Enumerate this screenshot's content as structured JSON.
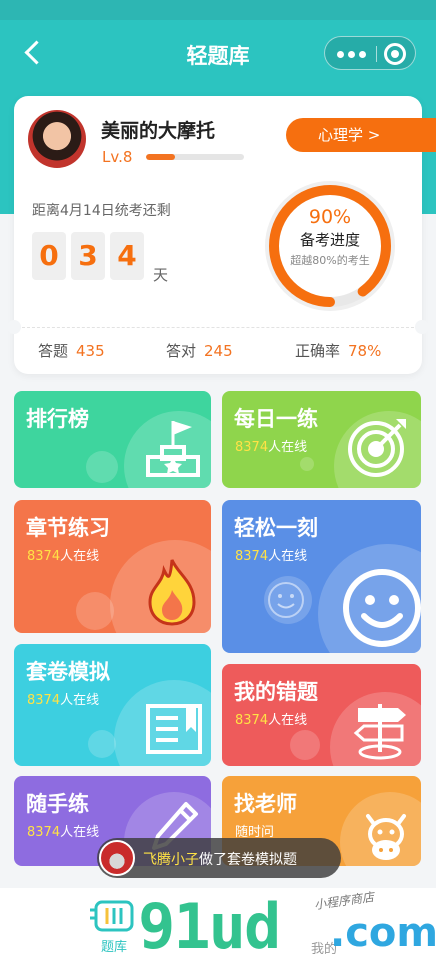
{
  "header": {
    "title": "轻题库"
  },
  "profile": {
    "name": "美丽的大摩托",
    "level": "Lv.8",
    "level_progress": 0.3,
    "subject_button": "心理学 >"
  },
  "countdown": {
    "label": "距离4月14日统考还剩",
    "digits": [
      "0",
      "3",
      "4"
    ],
    "unit": "天"
  },
  "progress": {
    "percent_text": "90%",
    "value": 0.9,
    "label": "备考进度",
    "sub": "超越80%的考生"
  },
  "stats": [
    {
      "label": "答题",
      "value": "435"
    },
    {
      "label": "答对",
      "value": "245"
    },
    {
      "label": "正确率",
      "value": "78%"
    }
  ],
  "tiles": [
    {
      "title": "排行榜",
      "count": "",
      "suffix": "",
      "color": "#3ed59e"
    },
    {
      "title": "每日一练",
      "count": "8374",
      "suffix": "人在线",
      "color": "#8fd54c"
    },
    {
      "title": "章节练习",
      "count": "8374",
      "suffix": "人在线",
      "color": "#f4754a"
    },
    {
      "title": "轻松一刻",
      "count": "8374",
      "suffix": "人在线",
      "color": "#5a8fe6"
    },
    {
      "title": "套卷模拟",
      "count": "8374",
      "suffix": "人在线",
      "color": "#3dcfe0"
    },
    {
      "title": "我的错题",
      "count": "8374",
      "suffix": "人在线",
      "color": "#ee5b5b"
    },
    {
      "title": "随手练",
      "count": "8374",
      "suffix": "人在线",
      "color": "#8e6ce0"
    },
    {
      "title": "找老师",
      "count": "",
      "suffix": "随时问",
      "color": "#f6a13a"
    }
  ],
  "toast": {
    "name": "飞腾小子",
    "text": "做了套卷模拟题"
  },
  "tabbar": {
    "tab1": "题库",
    "tab2": "我的"
  },
  "watermark": {
    "main": "91ud",
    "suffix": ".com",
    "caption": "小程序商店"
  }
}
